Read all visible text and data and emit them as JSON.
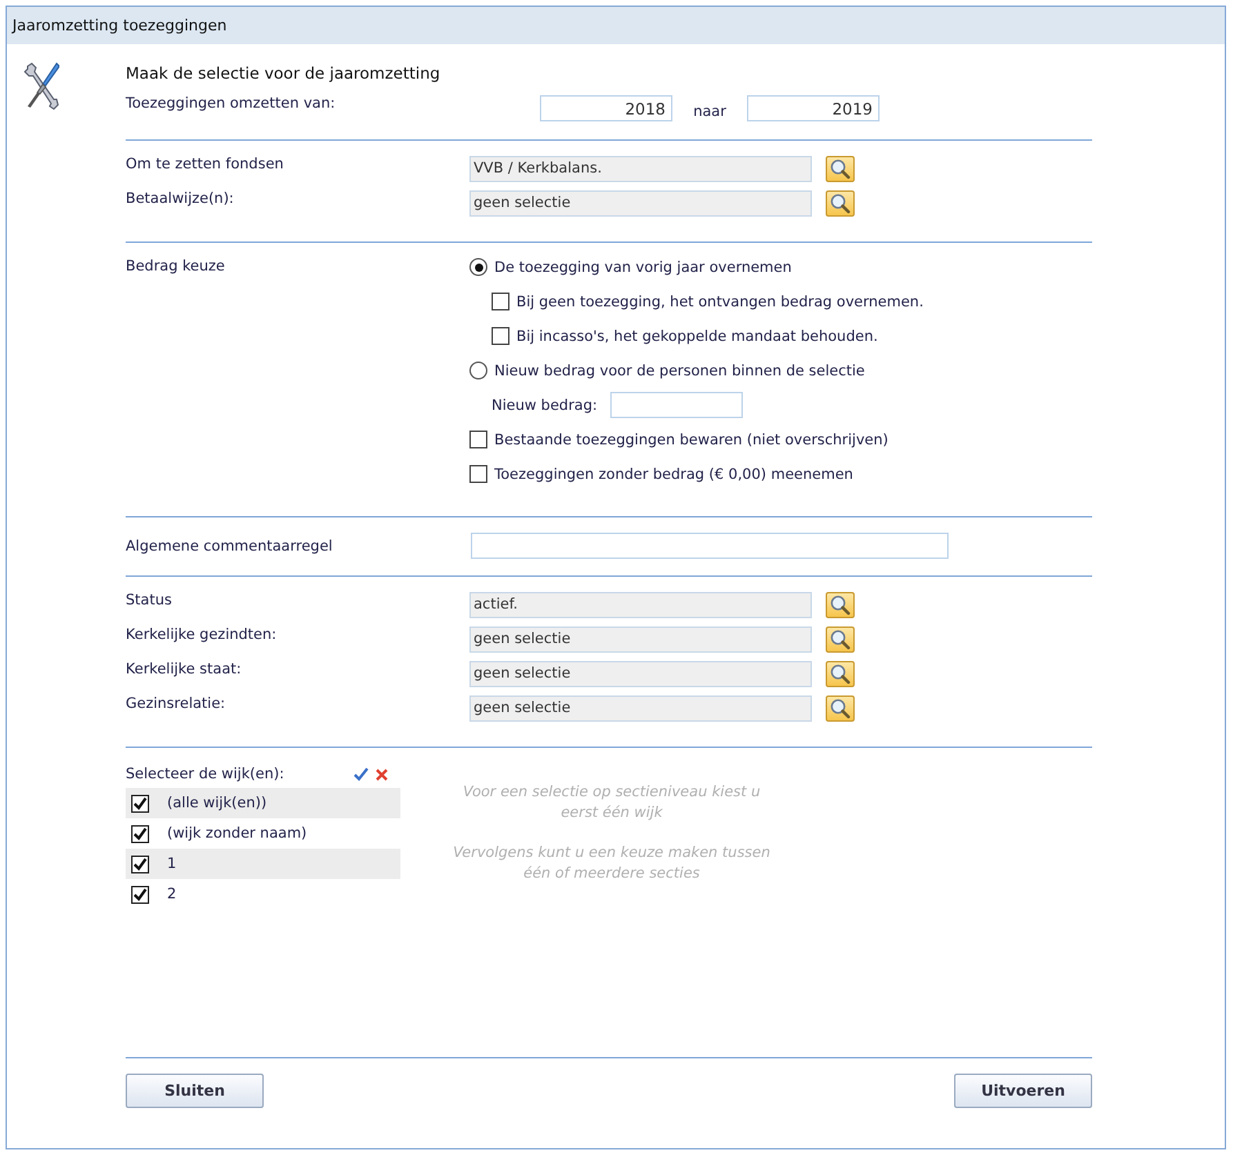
{
  "window": {
    "title": "Jaaromzetting toezeggingen"
  },
  "heading": "Maak de selectie voor de jaaromzetting",
  "conversion": {
    "label": "Toezeggingen omzetten van:",
    "from": "2018",
    "separator": "naar",
    "to": "2019"
  },
  "selection_fields": [
    {
      "label": "Om te zetten fondsen",
      "value": "VVB / Kerkbalans."
    },
    {
      "label": "Betaalwijze(n):",
      "value": "geen selectie"
    }
  ],
  "amount_choice": {
    "label": "Bedrag keuze",
    "options": [
      {
        "kind": "radio",
        "label": "De toezegging van vorig jaar overnemen",
        "selected": true,
        "children": [
          {
            "kind": "checkbox",
            "label": "Bij geen toezegging, het ontvangen bedrag overnemen.",
            "checked": false
          },
          {
            "kind": "checkbox",
            "label": "Bij incasso's, het gekoppelde mandaat behouden.",
            "checked": false
          }
        ]
      },
      {
        "kind": "radio",
        "label": "Nieuw bedrag voor de personen binnen de selectie",
        "selected": false,
        "children": [
          {
            "kind": "field",
            "label": "Nieuw bedrag:"
          }
        ]
      },
      {
        "kind": "checkbox",
        "label": "Bestaande toezeggingen bewaren (niet overschrijven)",
        "checked": false
      },
      {
        "kind": "checkbox",
        "label": "Toezeggingen zonder bedrag (€ 0,00) meenemen",
        "checked": false
      }
    ]
  },
  "comment": {
    "label": "Algemene commentaarregel"
  },
  "filters": [
    {
      "label": "Status",
      "value": "actief."
    },
    {
      "label": "Kerkelijke gezindten:",
      "value": "geen selectie"
    },
    {
      "label": "Kerkelijke staat:",
      "value": "geen selectie"
    },
    {
      "label": "Gezinsrelatie:",
      "value": "geen selectie"
    }
  ],
  "districts": {
    "label": "Selecteer de wijk(en):",
    "items": [
      {
        "label": "(alle wijk(en))",
        "checked": true
      },
      {
        "label": "(wijk zonder naam)",
        "checked": true
      },
      {
        "label": "1",
        "checked": true
      },
      {
        "label": "2",
        "checked": true
      }
    ]
  },
  "hints": [
    "Voor een selectie op sectieniveau kiest u eerst één wijk",
    "Vervolgens kunt u een keuze maken tussen één of meerdere secties"
  ],
  "buttons": [
    "Sluiten",
    "Uitvoeren"
  ]
}
